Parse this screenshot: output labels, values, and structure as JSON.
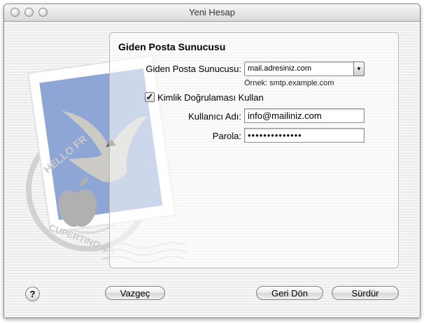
{
  "window": {
    "title": "Yeni Hesap"
  },
  "panel": {
    "title": "Giden Posta Sunucusu",
    "smtp_label": "Giden Posta Sunucusu:",
    "smtp_value": "mail.adresiniz.com",
    "smtp_hint": "Örnek: smtp.example.com",
    "auth_label": "Kimlik Doğrulaması Kullan",
    "auth_checked": true,
    "auth_check_glyph": "✓",
    "username_label": "Kullanıcı Adı:",
    "username_value": "info@mailiniz.com",
    "password_label": "Parola:",
    "password_value": "••••••••••••••"
  },
  "buttons": {
    "help": "?",
    "cancel": "Vazgeç",
    "back": "Geri Dön",
    "continue": "Sürdür"
  },
  "icons": {
    "dropdown": "▼",
    "help": "question-icon",
    "illustration": "mail-stamp-eagle-illustration"
  },
  "illustration": {
    "stamp_text": "HELLO FR",
    "postmark_text": "CUPERTINO CA"
  },
  "colors": {
    "stamp_blue": "#8ea6d6",
    "panel_border": "#b7b7b7"
  }
}
